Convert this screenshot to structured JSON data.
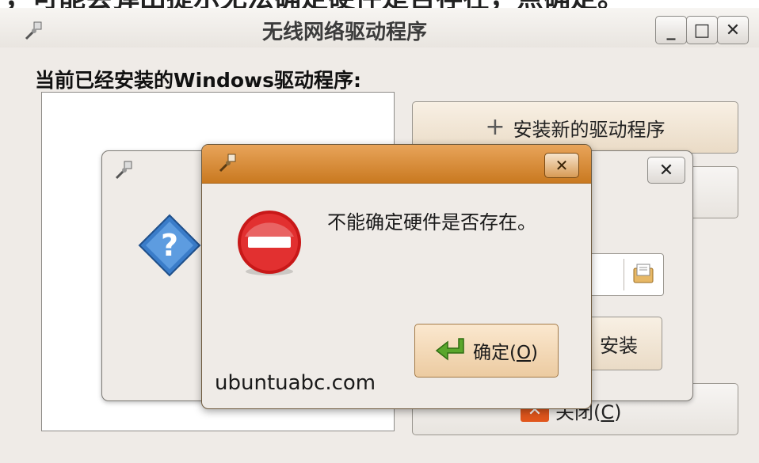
{
  "top_text": "，可能会弹出提示无法确定硬件是否存在，点确定。",
  "main_window": {
    "title": "无线网络驱动程序",
    "minimize_glyph": "_",
    "maximize_glyph": "□",
    "close_glyph": "✕",
    "heading": "当前已经安装的Windows驱动程序:",
    "install_new_label": "安装新的驱动程序",
    "install_label": "安装",
    "close_label_prefix": "关闭(",
    "close_label_key": "C",
    "close_label_suffix": ")"
  },
  "error_dialog": {
    "close_glyph": "✕",
    "message": "不能确定硬件是否存在。",
    "ok_label_prefix": "确定(",
    "ok_label_key": "O",
    "ok_label_suffix": ")",
    "watermark": "ubuntuabc.com"
  },
  "question_dialog": {
    "close_glyph": "✕"
  },
  "icons": {
    "app": "network-tool-icon",
    "question": "question-diamond-icon",
    "error": "stop-error-icon",
    "ok": "green-return-arrow-icon",
    "file": "document-open-icon"
  },
  "colors": {
    "window_bg": "#efebe7",
    "error_titlebar": "#d98b35",
    "button_warm": "#f1e3cf",
    "stop_red": "#d42020",
    "question_blue": "#2f6fbf",
    "ok_green": "#56a22a"
  }
}
